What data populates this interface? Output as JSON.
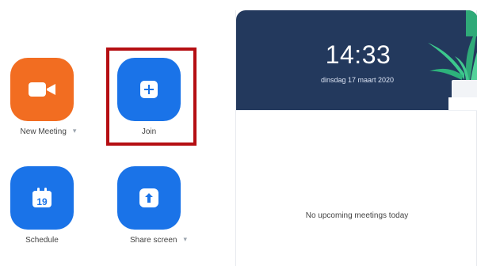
{
  "tiles": {
    "new_meeting": {
      "label": "New Meeting",
      "color": "#f26d21",
      "icon": "video-camera-icon",
      "has_dropdown": true
    },
    "join": {
      "label": "Join",
      "color": "#1a73e8",
      "icon": "plus-icon",
      "has_dropdown": false
    },
    "schedule": {
      "label": "Schedule",
      "color": "#1a73e8",
      "icon": "calendar-icon",
      "calendar_day": "19",
      "has_dropdown": false
    },
    "share_screen": {
      "label": "Share screen",
      "color": "#1a73e8",
      "icon": "upload-arrow-icon",
      "has_dropdown": true
    }
  },
  "highlight": {
    "target": "join",
    "color": "#b50e12"
  },
  "panel": {
    "time": "14:33",
    "date": "dinsdag 17 maart 2020",
    "empty_message": "No upcoming meetings today",
    "header_color": "#23395d"
  },
  "icons": {
    "dropdown": "chevron-down-icon"
  }
}
